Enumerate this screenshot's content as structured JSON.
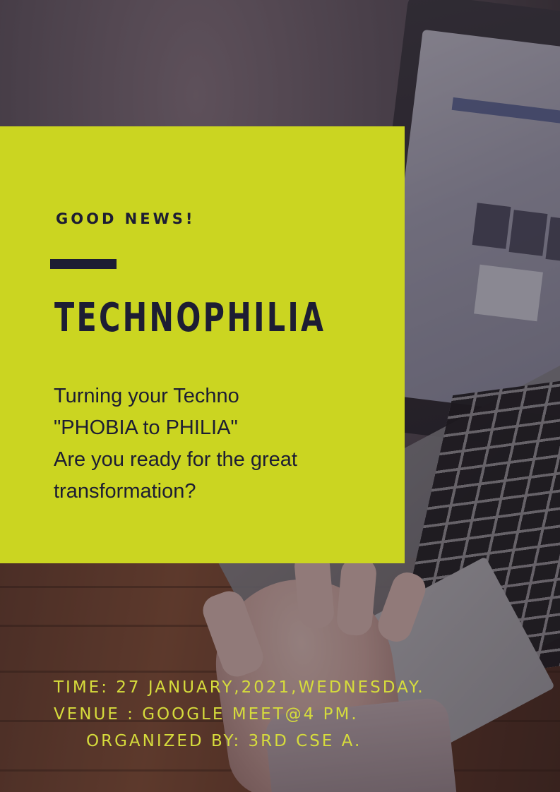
{
  "colors": {
    "accent_panel": "#cbd521",
    "dark_text": "#1d1d33",
    "detail_text": "#d6dc3c"
  },
  "background": {
    "subject": "person-typing-on-laptop-photo"
  },
  "poster": {
    "kicker": "GOOD NEWS!",
    "title": "TECHNOPHILIA",
    "body_lines": [
      "Turning your Techno",
      "\"PHOBIA to PHILIA\"",
      "Are you ready for the great",
      "transformation?"
    ],
    "details": {
      "time": "TIME: 27 JANUARY,2021,WEDNESDAY.",
      "venue": "VENUE : GOOGLE MEET@4 PM.",
      "organizer": "ORGANIZED BY: 3RD CSE A."
    }
  }
}
